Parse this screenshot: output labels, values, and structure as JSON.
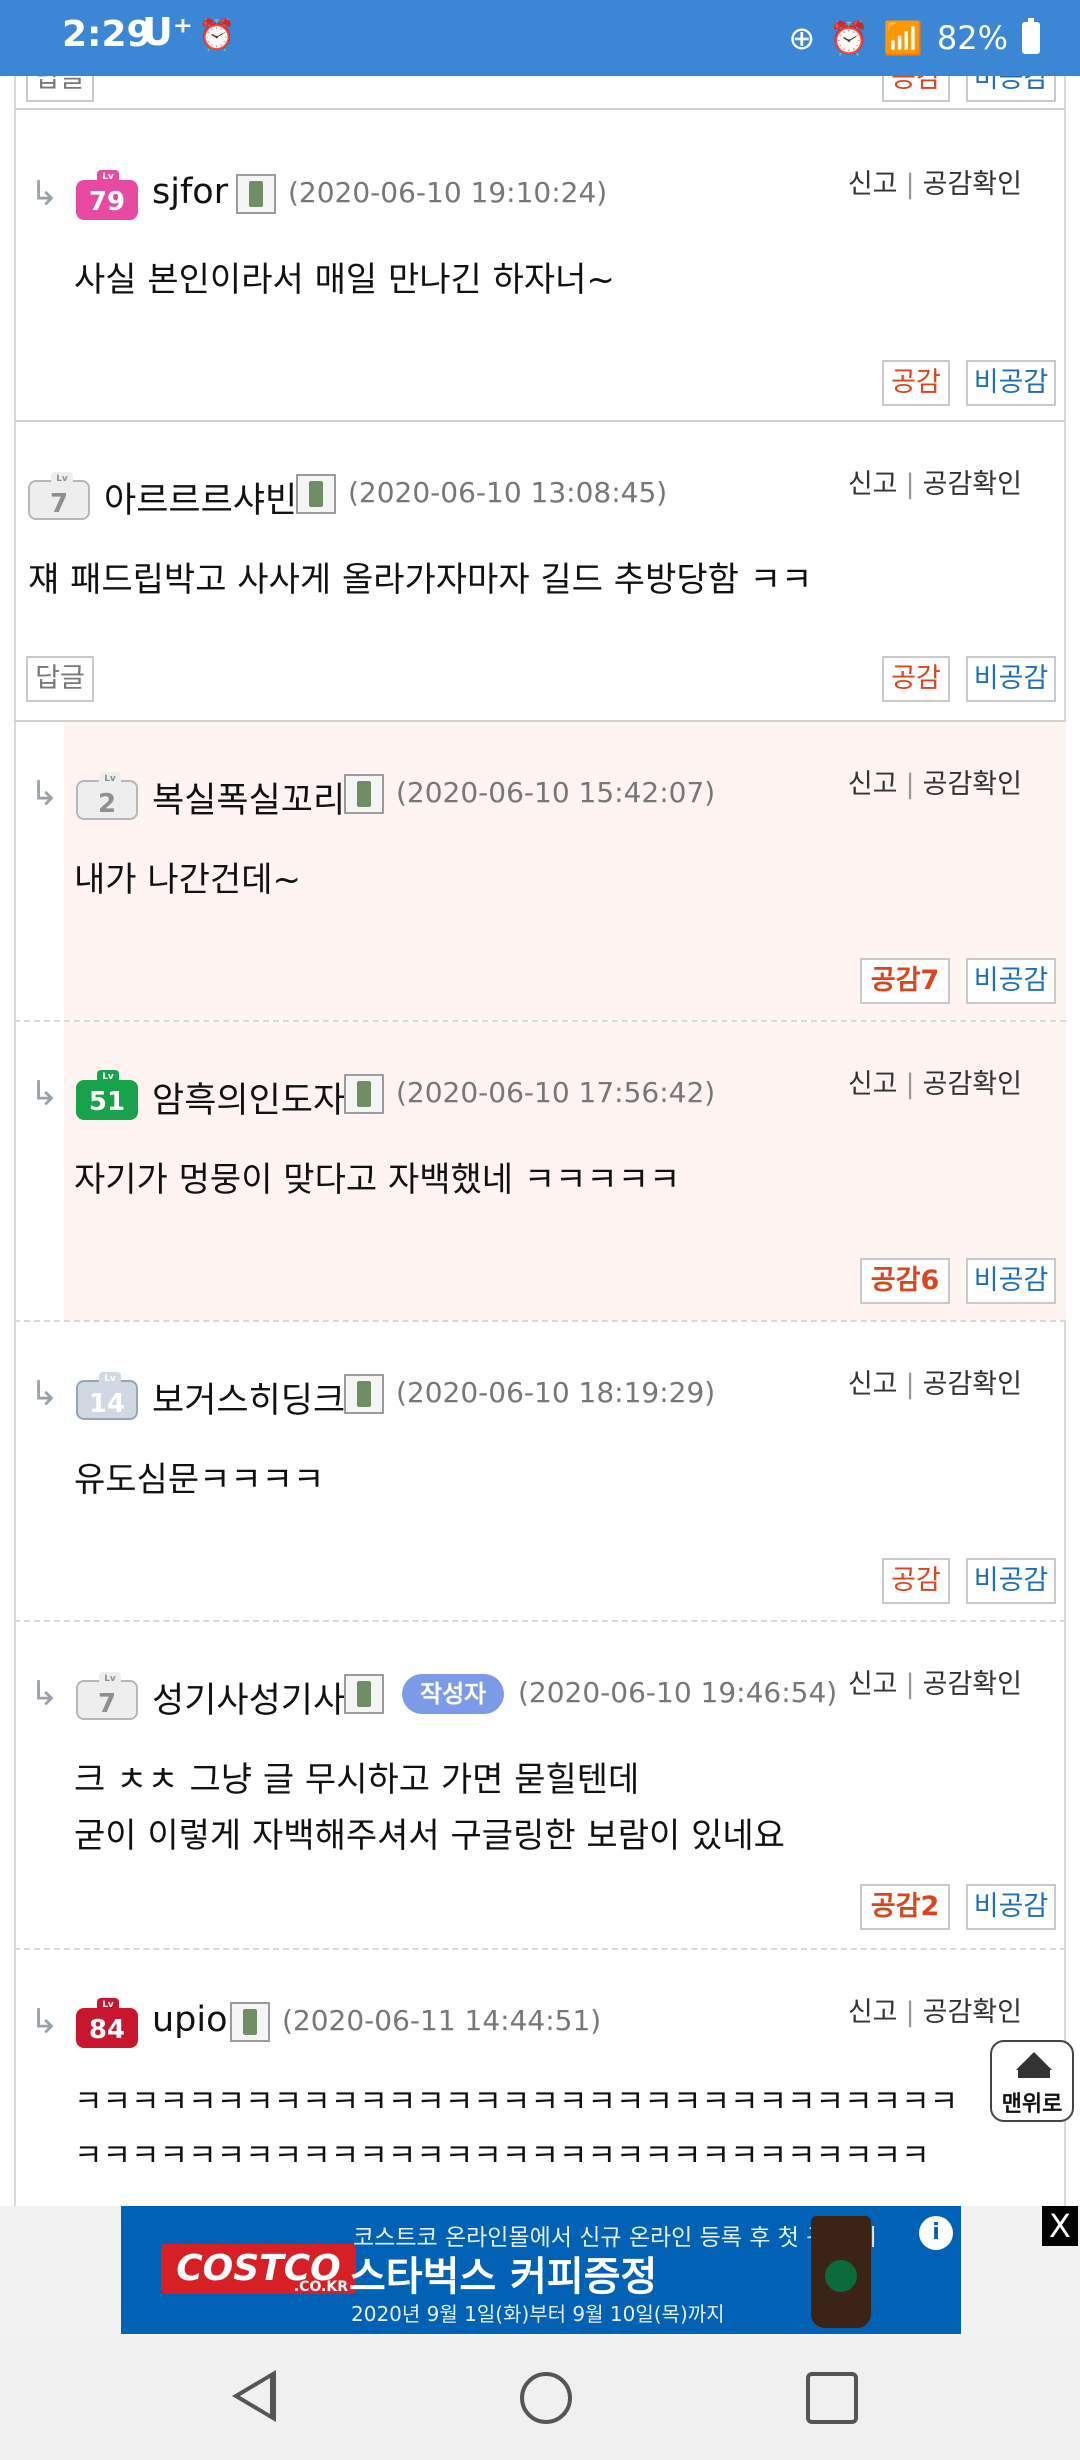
{
  "status_bar": {
    "time": "2:29",
    "carrier": "U⁺",
    "battery": "82%"
  },
  "labels": {
    "report": "신고",
    "check": "공감확인",
    "reply": "답글",
    "empathy": "공감",
    "non_empathy": "비공감",
    "writer_badge": "작성자",
    "to_top": "맨위로"
  },
  "comments": [
    {
      "level": "79",
      "nickname": "sjfor",
      "date": "(2020-06-10 19:10:24)",
      "lines": [
        "사실 본인이라서 매일 만나긴 하자너~"
      ]
    },
    {
      "level": "7",
      "nickname": "아르르르샤빈",
      "date": "(2020-06-10 13:08:45)",
      "lines": [
        "쟤 패드립박고 사사게 올라가자마자 길드 추방당함 ㅋㅋ"
      ]
    },
    {
      "level": "2",
      "nickname": "복실폭실꼬리",
      "date": "(2020-06-10 15:42:07)",
      "lines": [
        "내가 나간건데~"
      ],
      "empathy_count": "공감7"
    },
    {
      "level": "51",
      "nickname": "암흑의인도자",
      "date": "(2020-06-10 17:56:42)",
      "lines": [
        "자기가 멍뭉이 맞다고 자백했네  ㅋㅋㅋㅋㅋ"
      ],
      "empathy_count": "공감6"
    },
    {
      "level": "14",
      "nickname": "보거스히딩크",
      "date": "(2020-06-10 18:19:29)",
      "lines": [
        "유도심문ㅋㅋㅋㅋ"
      ]
    },
    {
      "level": "7",
      "nickname": "성기사성기사",
      "date": "(2020-06-10 19:46:54)",
      "lines": [
        "크 ㅊㅊ 그냥 글 무시하고 가면 묻힐텐데",
        "굳이 이렇게 자백해주셔서 구글링한 보람이 있네요"
      ],
      "empathy_count": "공감2"
    },
    {
      "level": "84",
      "nickname": "upio",
      "date": "(2020-06-11 14:44:51)",
      "lines": [
        "ㅋㅋㅋㅋㅋㅋㅋㅋㅋㅋㅋㅋㅋㅋㅋㅋㅋㅋㅋㅋㅋㅋㅋㅋㅋㅋㅋㅋㅋㅋㅋ",
        "ㅋㅋㅋㅋㅋㅋㅋㅋㅋㅋㅋㅋㅋㅋㅋㅋㅋㅋㅋㅋㅋㅋㅋㅋㅋㅋㅋㅋㅋㅋ"
      ]
    }
  ],
  "ad": {
    "logo": "COSTCO",
    "logo_sub": ".CO.KR",
    "line1": "코스트코 온라인몰에서 신규 온라인 등록 후 첫 구매 시",
    "line2": "스타벅스 커피증정",
    "line3": "2020년 9월 1일(화)부터 9월 10일(목)까지",
    "info": "i",
    "close": "X"
  },
  "colors": {
    "status_bar": "#3c86d6",
    "highlight": "#fff4f2",
    "empathy": "#d9461e",
    "non_empathy": "#1e6fb8",
    "ad_bg": "#0061b5"
  }
}
